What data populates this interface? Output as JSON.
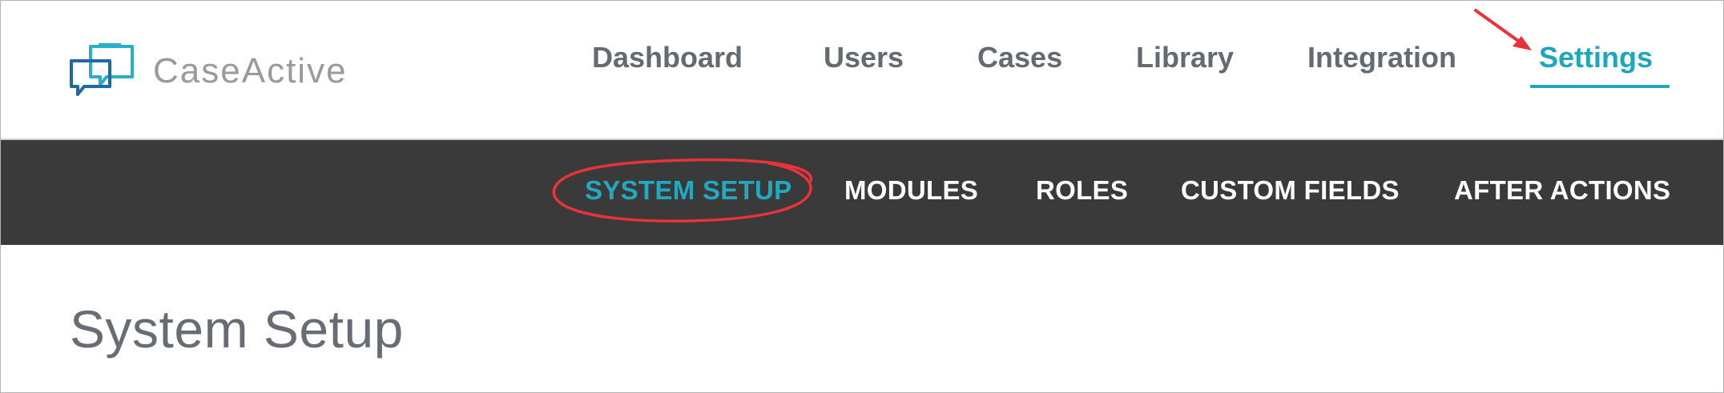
{
  "app": {
    "name": "CaseActive"
  },
  "main_nav": {
    "items": [
      {
        "label": "Dashboard",
        "active": false
      },
      {
        "label": "Users",
        "active": false
      },
      {
        "label": "Cases",
        "active": false
      },
      {
        "label": "Library",
        "active": false
      },
      {
        "label": "Integration",
        "active": false
      },
      {
        "label": "Settings",
        "active": true
      }
    ]
  },
  "sub_nav": {
    "items": [
      {
        "label": "SYSTEM SETUP",
        "active": true
      },
      {
        "label": "MODULES",
        "active": false
      },
      {
        "label": "ROLES",
        "active": false
      },
      {
        "label": "CUSTOM FIELDS",
        "active": false
      },
      {
        "label": "AFTER ACTIONS",
        "active": false
      }
    ]
  },
  "page": {
    "title": "System Setup"
  },
  "colors": {
    "accent": "#1fa6bf",
    "nav_text": "#636b70",
    "subnav_bg": "#3a3a3a",
    "annotation": "#e8333a"
  },
  "icons": {
    "logo": "chat-bubbles-logo-icon"
  }
}
